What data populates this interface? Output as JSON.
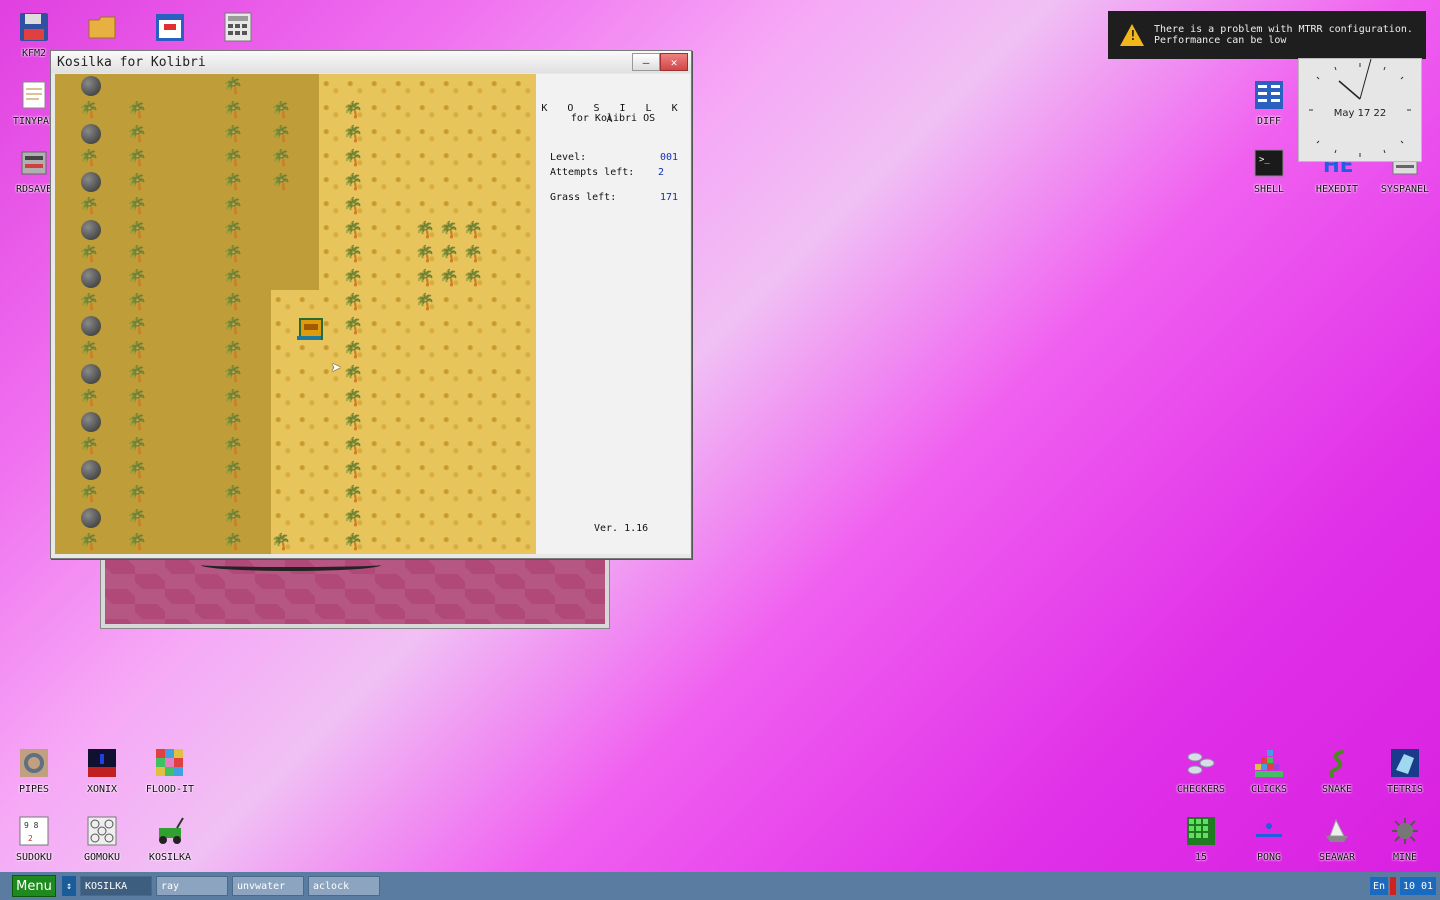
{
  "desktop": {
    "icons": [
      {
        "label": "KFM2",
        "icon": "floppy-icon"
      },
      {
        "label": "",
        "icon": "folder-icon"
      },
      {
        "label": "",
        "icon": "calendar-icon"
      },
      {
        "label": "",
        "icon": "calculator-icon"
      },
      {
        "label": "TINYPAD",
        "icon": "notepad-icon"
      },
      {
        "label": "RDSAVE",
        "icon": "rdsave-icon"
      },
      {
        "label": "DIFF",
        "icon": "diff-icon"
      },
      {
        "label": "SHELL",
        "icon": "shell-icon"
      },
      {
        "label": "HEXEDIT",
        "icon": "hexedit-icon"
      },
      {
        "label": "SYSPANEL",
        "icon": "syspanel-icon"
      },
      {
        "label": "PIPES",
        "icon": "pipes-icon"
      },
      {
        "label": "XONIX",
        "icon": "xonix-icon"
      },
      {
        "label": "FLOOD-IT",
        "icon": "flood-it-icon"
      },
      {
        "label": "SUDOKU",
        "icon": "sudoku-icon"
      },
      {
        "label": "GOMOKU",
        "icon": "gomoku-icon"
      },
      {
        "label": "KOSILKA",
        "icon": "kosilka-icon"
      },
      {
        "label": "CHECKERS",
        "icon": "checkers-icon"
      },
      {
        "label": "CLICKS",
        "icon": "clicks-icon"
      },
      {
        "label": "SNAKE",
        "icon": "snake-icon"
      },
      {
        "label": "TETRIS",
        "icon": "tetris-icon"
      },
      {
        "label": "15",
        "icon": "fifteen-icon"
      },
      {
        "label": "PONG",
        "icon": "pong-icon"
      },
      {
        "label": "SEAWAR",
        "icon": "seawar-icon"
      },
      {
        "label": "MINE",
        "icon": "mine-icon"
      }
    ]
  },
  "window": {
    "title": "Kosilka for Kolibri",
    "minimize": "–",
    "close": "✕",
    "panel": {
      "title": "K O S I L K A",
      "subtitle": "for Kolibri OS",
      "level_label": "Level:",
      "level_value": "001",
      "attempts_label": "Attempts left:",
      "attempts_value": "2",
      "grass_label": "Grass left:",
      "grass_value": "171",
      "version": "Ver. 1.16"
    }
  },
  "notification": {
    "line1": "There is a problem with MTRR configuration.",
    "line2": "Performance can be low"
  },
  "clock": {
    "date": "May 17 22"
  },
  "taskbar": {
    "menu": "Menu",
    "tasks": [
      "KOSILKA",
      "ray",
      "unvwater",
      "aclock"
    ],
    "lang": "En",
    "time": "10 01"
  }
}
